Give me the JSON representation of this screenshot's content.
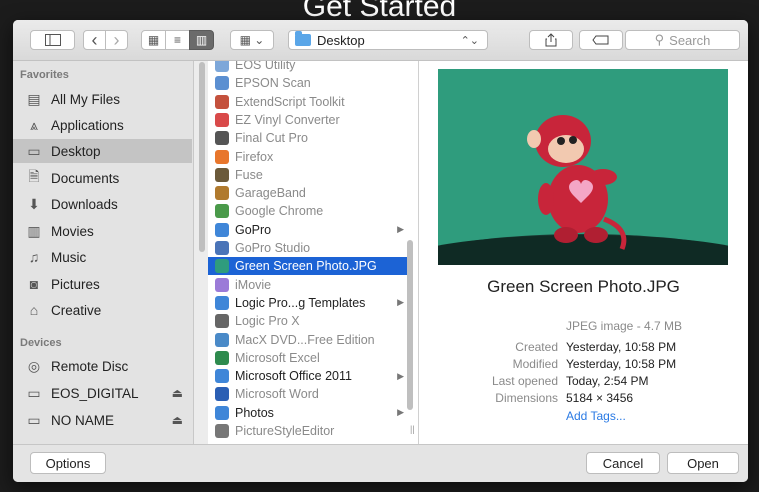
{
  "background_title": "Get Started",
  "toolbar": {
    "location": "Desktop",
    "search_placeholder": "Search",
    "back_glyph": "‹",
    "forward_glyph": "›"
  },
  "sidebar": {
    "favorites_heading": "Favorites",
    "favorites": [
      {
        "label": "All My Files",
        "icon": "all-files-icon"
      },
      {
        "label": "Applications",
        "icon": "applications-icon"
      },
      {
        "label": "Desktop",
        "icon": "desktop-icon",
        "selected": true
      },
      {
        "label": "Documents",
        "icon": "documents-icon"
      },
      {
        "label": "Downloads",
        "icon": "downloads-icon"
      },
      {
        "label": "Movies",
        "icon": "movies-icon"
      },
      {
        "label": "Music",
        "icon": "music-icon"
      },
      {
        "label": "Pictures",
        "icon": "pictures-icon"
      },
      {
        "label": "Creative",
        "icon": "home-icon"
      }
    ],
    "devices_heading": "Devices",
    "devices": [
      {
        "label": "Remote Disc",
        "icon": "disc-icon"
      },
      {
        "label": "EOS_DIGITAL",
        "icon": "drive-icon",
        "eject": true
      },
      {
        "label": "NO NAME",
        "icon": "drive-icon",
        "eject": true
      }
    ]
  },
  "files": [
    {
      "name": "EOS Utility",
      "color": "#7da7d9",
      "dim": true
    },
    {
      "name": "EPSON Scan",
      "color": "#5b8fd1",
      "dim": true
    },
    {
      "name": "ExtendScript Toolkit",
      "color": "#c4513d",
      "dim": true
    },
    {
      "name": "EZ Vinyl Converter",
      "color": "#d94a4a",
      "dim": true
    },
    {
      "name": "Final Cut Pro",
      "color": "#555555",
      "dim": true
    },
    {
      "name": "Firefox",
      "color": "#e8762c",
      "dim": true
    },
    {
      "name": "Fuse",
      "color": "#6b5a3a",
      "dim": true
    },
    {
      "name": "GarageBand",
      "color": "#b07a2e",
      "dim": true
    },
    {
      "name": "Google Chrome",
      "color": "#4a9a4a",
      "dim": true
    },
    {
      "name": "GoPro",
      "color": "#3f86d8",
      "folder": true
    },
    {
      "name": "GoPro Studio",
      "color": "#4a74b8",
      "dim": true
    },
    {
      "name": "Green Screen Photo.JPG",
      "color": "#2f9c7d",
      "selected": true
    },
    {
      "name": "iMovie",
      "color": "#9b7bd8",
      "dim": true
    },
    {
      "name": "Logic Pro...g Templates",
      "color": "#3f86d8",
      "folder": true
    },
    {
      "name": "Logic Pro X",
      "color": "#666666",
      "dim": true
    },
    {
      "name": "MacX DVD...Free Edition",
      "color": "#4a8ac8",
      "dim": true
    },
    {
      "name": "Microsoft Excel",
      "color": "#2e8b4e",
      "dim": true
    },
    {
      "name": "Microsoft Office 2011",
      "color": "#3f86d8",
      "folder": true
    },
    {
      "name": "Microsoft Word",
      "color": "#2b5fb4",
      "dim": true
    },
    {
      "name": "Photos",
      "color": "#3f86d8",
      "folder": true
    },
    {
      "name": "PictureStyleEditor",
      "color": "#777777",
      "dim": true
    }
  ],
  "preview": {
    "filename": "Green Screen Photo.JPG",
    "kind": "JPEG image - 4.7 MB",
    "meta": [
      {
        "key": "Created",
        "value": "Yesterday, 10:58 PM"
      },
      {
        "key": "Modified",
        "value": "Yesterday, 10:58 PM"
      },
      {
        "key": "Last opened",
        "value": "Today, 2:54 PM"
      },
      {
        "key": "Dimensions",
        "value": "5184 × 3456"
      }
    ],
    "add_tags": "Add Tags..."
  },
  "footer": {
    "options": "Options",
    "cancel": "Cancel",
    "open": "Open"
  },
  "colors": {
    "selection": "#1c63d5",
    "green_screen": "#2f9c7d",
    "link": "#2a7ae4"
  }
}
